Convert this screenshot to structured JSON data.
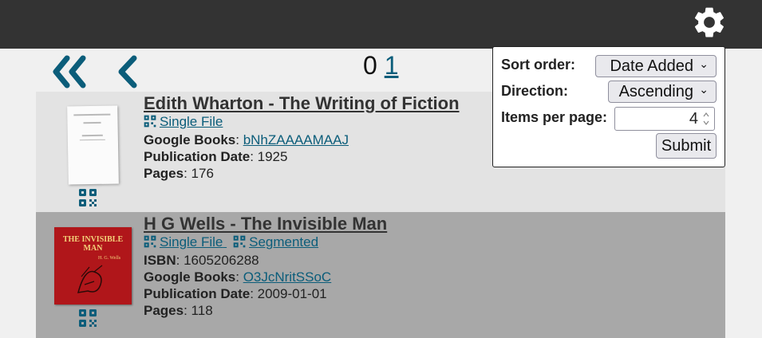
{
  "pagination": {
    "current_page": "0",
    "next_page": "1"
  },
  "books": [
    {
      "title": "Edith Wharton - The Writing of Fiction",
      "links": [
        "Single File"
      ],
      "fields": [
        {
          "label": "Google Books",
          "value": "bNhZAAAAMAAJ",
          "is_link": true
        },
        {
          "label": "Publication Date",
          "value": "1925",
          "is_link": false
        },
        {
          "label": "Pages",
          "value": "176",
          "is_link": false
        }
      ]
    },
    {
      "title": "H G Wells - The Invisible Man",
      "links": [
        "Single File",
        "Segmented"
      ],
      "cover_text": {
        "title": "THE INVISIBLE MAN",
        "author": "H. G. Wells"
      },
      "fields": [
        {
          "label": "ISBN",
          "value": "1605206288",
          "is_link": false
        },
        {
          "label": "Google Books",
          "value": "O3JcNritSSoC",
          "is_link": true
        },
        {
          "label": "Publication Date",
          "value": "2009-01-01",
          "is_link": false
        },
        {
          "label": "Pages",
          "value": "118",
          "is_link": false
        }
      ]
    }
  ],
  "sort_panel": {
    "sort_order_label": "Sort order:",
    "sort_order_value": "Date Added",
    "direction_label": "Direction:",
    "direction_value": "Ascending",
    "items_per_page_label": "Items per page:",
    "items_per_page_value": "4",
    "submit_label": "Submit"
  },
  "icons": {
    "settings": "gear-icon",
    "first_page": "double-chevron-left-icon",
    "previous_page": "chevron-left-icon",
    "qr_code": "qr-code-icon"
  },
  "colors": {
    "header_bg": "#333333",
    "link": "#0b5d7a",
    "row_light": "#e3e3e3",
    "row_dark": "#a8a8a8"
  }
}
